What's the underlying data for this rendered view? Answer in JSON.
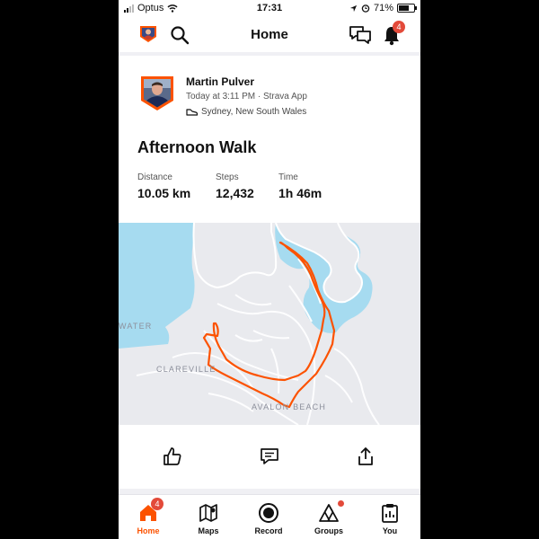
{
  "status_bar": {
    "carrier": "Optus",
    "time": "17:31",
    "battery": "71%",
    "battery_level": 0.71
  },
  "header": {
    "title": "Home",
    "notifications_count": "4"
  },
  "activity": {
    "athlete_name": "Martin Pulver",
    "meta": "Today at 3:11 PM · Strava App",
    "location": "Sydney, New South Wales",
    "title": "Afternoon Walk",
    "stats": [
      {
        "label": "Distance",
        "value": "10.05 km"
      },
      {
        "label": "Steps",
        "value": "12,432"
      },
      {
        "label": "Time",
        "value": "1h 46m"
      }
    ],
    "map": {
      "labels": {
        "water": "WATER",
        "clareville": "CLAREVILLE",
        "avalon_beach": "AVALON BEACH"
      },
      "route_color": "#fc5200",
      "water_color": "#a6dbf0",
      "land_color": "#e9eaee"
    }
  },
  "tabs": [
    {
      "label": "Home",
      "badge": "4"
    },
    {
      "label": "Maps"
    },
    {
      "label": "Record"
    },
    {
      "label": "Groups"
    },
    {
      "label": "You"
    }
  ],
  "colors": {
    "accent": "#fc5200",
    "badge": "#e34a3a"
  }
}
